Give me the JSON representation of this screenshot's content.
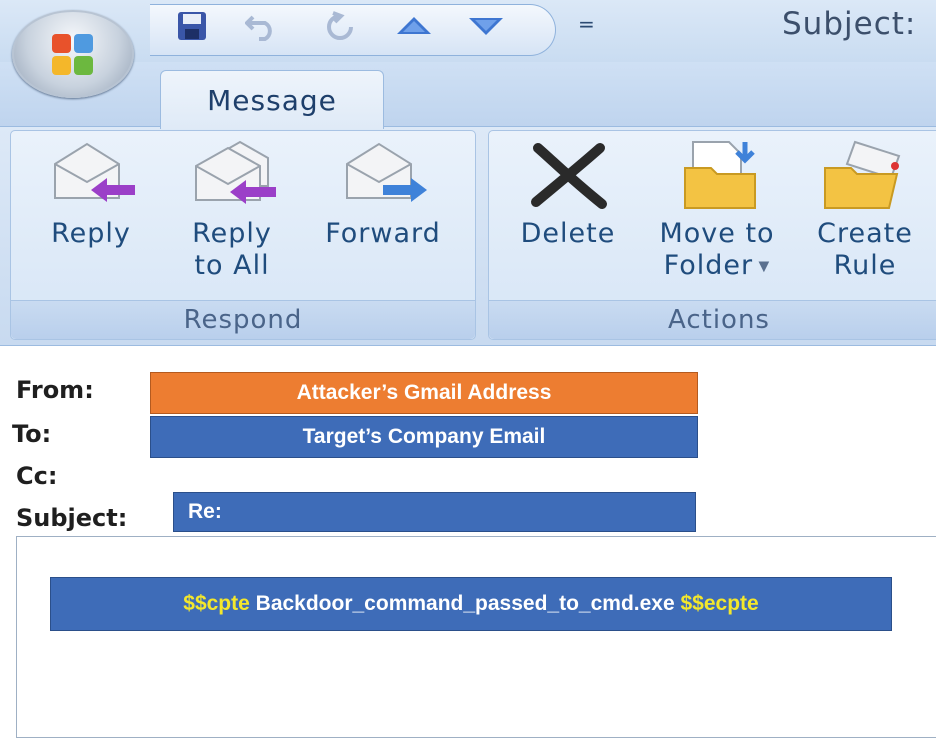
{
  "window": {
    "title": "Subject:"
  },
  "tabs": [
    {
      "label": "Message"
    }
  ],
  "quick_access": {
    "items": [
      "save-icon",
      "undo-icon",
      "redo-icon",
      "previous-item-icon",
      "next-item-icon"
    ],
    "dropdown_glyph": "="
  },
  "ribbon": {
    "groups": [
      {
        "label": "Respond",
        "buttons": [
          {
            "label": "Reply",
            "icon": "reply-icon"
          },
          {
            "label": "Reply\nto All",
            "icon": "reply-all-icon"
          },
          {
            "label": "Forward",
            "icon": "forward-icon"
          }
        ]
      },
      {
        "label": "Actions",
        "buttons": [
          {
            "label": "Delete",
            "icon": "delete-icon"
          },
          {
            "label": "Move to\nFolder",
            "icon": "move-to-folder-icon"
          },
          {
            "label": "Create\nRule",
            "icon": "create-rule-icon"
          }
        ]
      }
    ]
  },
  "message": {
    "from_label": "From:",
    "from_value": "Attacker’s Gmail Address",
    "to_label": "To:",
    "to_value": "Target’s Company Email",
    "cc_label": "Cc:",
    "subject_label": "Subject:",
    "subject_value": "Re:",
    "body": {
      "start_tag": "$$cpte",
      "command": " Backdoor_command_passed_to_cmd.exe ",
      "end_tag": "$$ecpte"
    }
  },
  "colors": {
    "from_bg": "#ed7d31",
    "to_bg": "#3e6cb8",
    "subject_bg": "#3e6cb8",
    "tag_text": "#f3e72c"
  }
}
